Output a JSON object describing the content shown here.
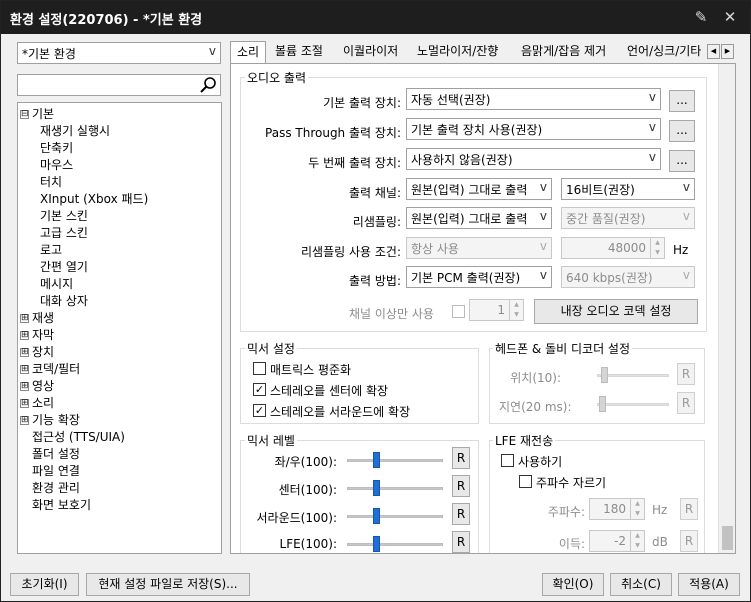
{
  "window": {
    "title": "환경 설정(220706) - *기본 환경"
  },
  "profile_select": {
    "value": "*기본 환경"
  },
  "search": {
    "placeholder": ""
  },
  "tree": [
    {
      "label": "기본",
      "expander": "⊟"
    },
    {
      "label": "재생기 실행시"
    },
    {
      "label": "단축키"
    },
    {
      "label": "마우스"
    },
    {
      "label": "터치"
    },
    {
      "label": "XInput (Xbox 패드)"
    },
    {
      "label": "기본 스킨"
    },
    {
      "label": "고급 스킨"
    },
    {
      "label": "로고"
    },
    {
      "label": "간편 열기"
    },
    {
      "label": "메시지"
    },
    {
      "label": "대화 상자"
    },
    {
      "label": "재생",
      "expander": "⊞"
    },
    {
      "label": "자막",
      "expander": "⊞"
    },
    {
      "label": "장치",
      "expander": "⊞"
    },
    {
      "label": "코덱/필터",
      "expander": "⊞"
    },
    {
      "label": "영상",
      "expander": "⊞"
    },
    {
      "label": "소리",
      "expander": "⊞"
    },
    {
      "label": "기능 확장",
      "expander": "⊞"
    },
    {
      "label": "접근성 (TTS/UIA)"
    },
    {
      "label": "폴더 설정"
    },
    {
      "label": "파일 연결"
    },
    {
      "label": "환경 관리"
    },
    {
      "label": "화면 보호기"
    }
  ],
  "tabs": [
    "소리",
    "볼륨 조절",
    "이퀄라이저",
    "노멀라이저/잔향",
    "음맑게/잡음 제거",
    "언어/싱크/기타"
  ],
  "audio_output": {
    "title": "오디오 출력",
    "device_label": "기본 출력 장치:",
    "device_value": "자동 선택(권장)",
    "passthrough_label": "Pass Through 출력 장치:",
    "passthrough_value": "기본 출력 장치 사용(권장)",
    "second_label": "두 번째 출력 장치:",
    "second_value": "사용하지 않음(권장)",
    "browse": "...",
    "channel_label": "출력 채널:",
    "channel_value": "원본(입력) 그대로 출력",
    "bits_value": "16비트(권장)",
    "resample_label": "리샘플링:",
    "resample_value": "원본(입력) 그대로 출력",
    "quality_value": "중간 품질(권장)",
    "resample_cond_label": "리샘플링 사용 조건:",
    "resample_cond_value": "항상 사용",
    "rate_value": "48000",
    "rate_unit": "Hz",
    "method_label": "출력 방법:",
    "method_value": "기본 PCM 출력(권장)",
    "kbps_value": "640 kbps(권장)",
    "channel_min_label": "채널 이상만 사용",
    "channel_min_value": "1",
    "codec_button": "내장 오디오 코덱 설정"
  },
  "mixer_settings": {
    "title": "믹서 설정",
    "items": [
      {
        "label": "매트릭스 평준화",
        "checked": ""
      },
      {
        "label": "스테레오를 센터에 확장",
        "checked": "✓"
      },
      {
        "label": "스테레오를 서라운드에 확장",
        "checked": "✓"
      }
    ]
  },
  "headphone": {
    "title": "헤드폰 & 돌비 디코더 설정",
    "pos_label": "위치(10):",
    "delay_label": "지연(20 ms):",
    "reset": "R"
  },
  "mixer_level": {
    "title": "믹서 레벨",
    "rows": [
      {
        "label": "좌/우(100):",
        "level": 100
      },
      {
        "label": "센터(100):",
        "level": 100
      },
      {
        "label": "서라운드(100):",
        "level": 100
      },
      {
        "label": "LFE(100):",
        "level": 100
      }
    ],
    "reset": "R"
  },
  "lfe": {
    "title": "LFE 재전송",
    "enable_label": "사용하기",
    "cut_label": "주파수 자르기",
    "freq_label": "주파수:",
    "freq_value": "180",
    "freq_unit": "Hz",
    "gain_label": "이득:",
    "gain_value": "-2",
    "gain_unit": "dB",
    "reset": "R"
  },
  "footer": {
    "reset": "초기화(I)",
    "save_file": "현재 설정 파일로 저장(S)...",
    "ok": "확인(O)",
    "cancel": "취소(C)",
    "apply": "적용(A)"
  }
}
